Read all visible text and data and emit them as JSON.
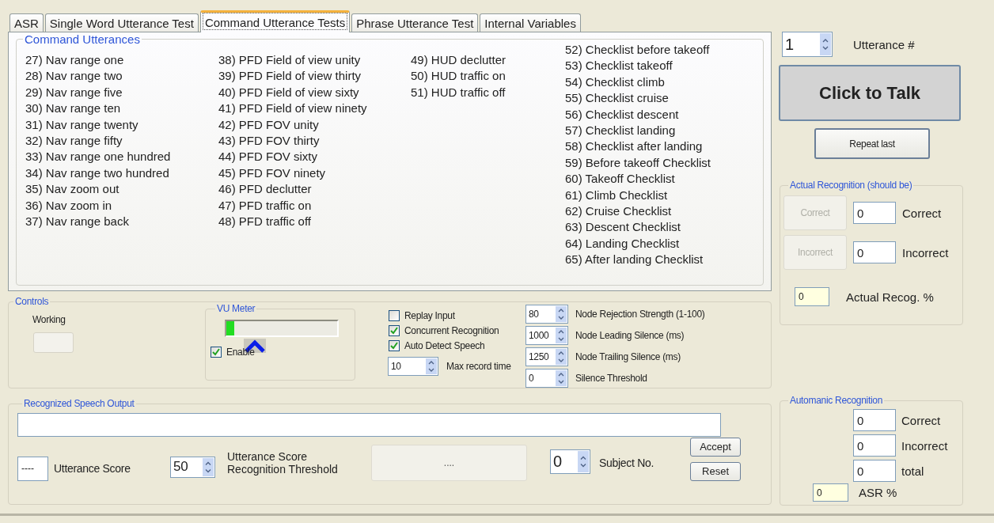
{
  "tabs": [
    {
      "label": "ASR",
      "selected": false
    },
    {
      "label": "Single Word Utterance Test",
      "selected": false
    },
    {
      "label": "Command Utterance Tests",
      "selected": true
    },
    {
      "label": "Phrase Utterance Test",
      "selected": false
    },
    {
      "label": "Internal Variables",
      "selected": false
    }
  ],
  "command_utterances": {
    "title": "Command Utterances",
    "columns": [
      [
        "27) Nav range one",
        "28) Nav range two",
        "29) Nav range five",
        "30) Nav range ten",
        "31) Nav range twenty",
        "32) Nav range fifty",
        "33) Nav range one hundred",
        "34) Nav range two hundred",
        "35) Nav zoom out",
        "36) Nav zoom in",
        "37) Nav range back"
      ],
      [
        "38) PFD Field of view unity",
        "39) PFD Field of view thirty",
        "40) PFD Field of view sixty",
        "41) PFD Field of view ninety",
        "42) PFD FOV unity",
        "43) PFD FOV thirty",
        "44) PFD FOV sixty",
        "45) PFD FOV ninety",
        "46) PFD declutter",
        "47) PFD traffic on",
        "48) PFD traffic off"
      ],
      [
        "49) HUD declutter",
        "50) HUD traffic on",
        "51) HUD traffic off"
      ],
      [
        "52) Checklist before takeoff",
        "53) Checklist takeoff",
        "54) Checklist climb",
        "55) Checklist cruise",
        "56) Checklist descent",
        "57) Checklist landing",
        "58) Checklist after landing",
        "59) Before takeoff Checklist",
        "60) Takeoff Checklist",
        "61) Climb Checklist",
        "62) Cruise Checklist",
        "63) Descent Checklist",
        "64) Landing Checklist",
        "65) After landing Checklist"
      ]
    ]
  },
  "controls": {
    "title": "Controls",
    "working_label": "Working",
    "vu_meter": {
      "title": "VU Meter",
      "level": 0.07,
      "enable": {
        "label": "Enable",
        "checked": true
      }
    },
    "options": [
      {
        "label": "Replay Input",
        "checked": false
      },
      {
        "label": "Concurrent Recognition",
        "checked": true
      },
      {
        "label": "Auto Detect  Speech",
        "checked": true
      }
    ],
    "max_record": {
      "value": "10",
      "label": "Max record time"
    },
    "node_settings": [
      {
        "value": "80",
        "label": "Node Rejection Strength (1-100)"
      },
      {
        "value": "1000",
        "label": "Node Leading Silence (ms)"
      },
      {
        "value": "1250",
        "label": "Node Trailing Silence (ms)"
      },
      {
        "value": "0",
        "label": "Silence Threshold"
      }
    ]
  },
  "recognized_speech_output": {
    "title": "Recognized Speech Output",
    "utterance_score": {
      "value": "----",
      "label": "Utterance Score"
    },
    "threshold": {
      "value": "50",
      "label": "Utterance Score Recognition Threshold"
    },
    "result": "....",
    "subject": {
      "value": "0",
      "label": "Subject No."
    },
    "buttons": [
      "Accept",
      "Reset"
    ]
  },
  "utterance_number": {
    "value": "1",
    "label": "Utterance #"
  },
  "click_to_talk": "Click to Talk",
  "repeat_last": "Repeat last",
  "actual_recognition": {
    "title": "Actual Recognition (should be)",
    "rows": [
      {
        "button": "Correct",
        "disabled": true,
        "value": "0",
        "label": "Correct"
      },
      {
        "button": "Incorrect",
        "disabled": true,
        "value": "0",
        "label": "Incorrect"
      }
    ],
    "percent": {
      "value": "0",
      "label": "Actual Recog. %"
    }
  },
  "automatic_recognition": {
    "title": "Automanic Recognition",
    "rows": [
      {
        "value": "0",
        "label": "Correct"
      },
      {
        "value": "0",
        "label": "Incorrect"
      },
      {
        "value": "0",
        "label": "total"
      }
    ],
    "percent": {
      "value": "0",
      "label": "ASR %"
    }
  }
}
